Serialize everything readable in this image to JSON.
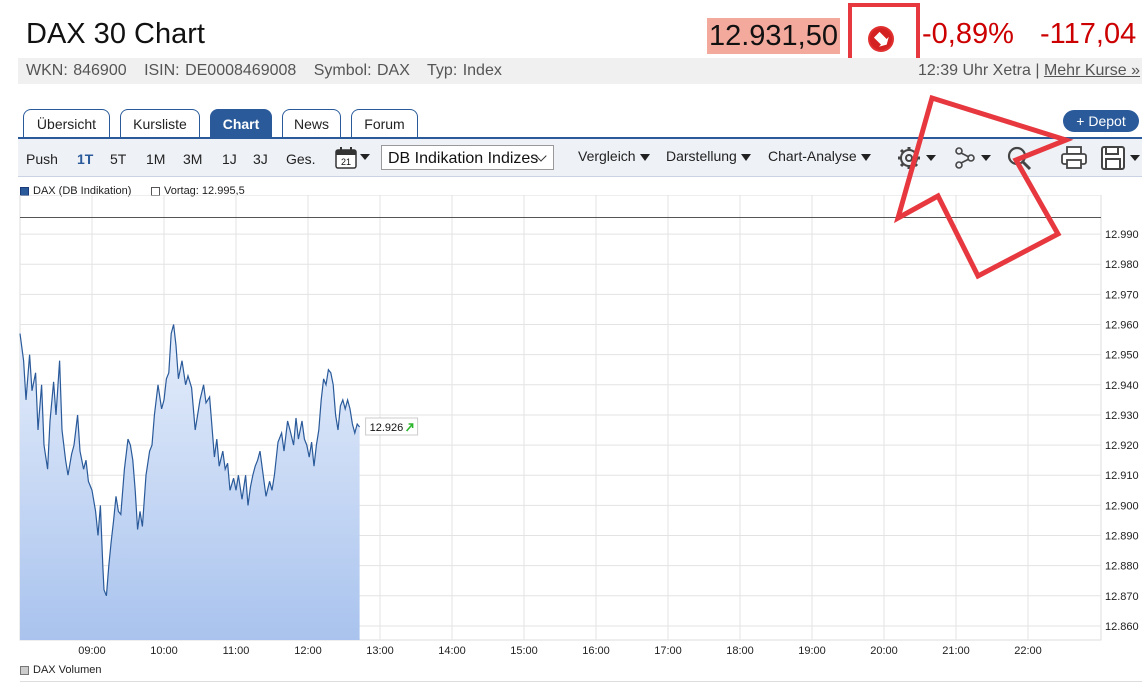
{
  "header": {
    "title": "DAX 30 Chart",
    "price": "12.931,50",
    "change_pct": "-0,89%",
    "change_abs": "-117,04",
    "wkn": "WKN: 846900",
    "isin": "ISIN: DE0008469008",
    "symbol": "Symbol: DAX",
    "type": "Typ: Index",
    "time_exchange": "12:39 Uhr Xetra | ",
    "more_quotes": "Mehr Kurse »",
    "colors": {
      "negative": "#cc0000",
      "price_bg": "#f4a99d",
      "highlight": "#e8383f"
    }
  },
  "tabs": [
    "Übersicht",
    "Kursliste",
    "Chart",
    "News",
    "Forum"
  ],
  "active_tab": "Chart",
  "depot_button": "+ Depot",
  "toolbar": {
    "push": "Push",
    "ranges": [
      "1T",
      "5T",
      "1M",
      "3M",
      "1J",
      "3J",
      "Ges."
    ],
    "active_range": "1T",
    "calendar_day": "21",
    "data_source": "DB Indikation Indizes",
    "vergleich": "Vergleich",
    "darstellung": "Darstellung",
    "chart_analyse": "Chart-Analyse",
    "icons": [
      "calendar-icon",
      "settings-icon",
      "network-icon",
      "zoom-icon",
      "print-icon",
      "save-icon"
    ]
  },
  "legend": {
    "series": "DAX (DB Indikation)",
    "previous": "Vortag: 12.995,5",
    "volume": "DAX Volumen"
  },
  "chart_data": {
    "type": "area",
    "x_ticks": [
      "09:00",
      "10:00",
      "11:00",
      "12:00",
      "13:00",
      "14:00",
      "15:00",
      "16:00",
      "17:00",
      "18:00",
      "19:00",
      "20:00",
      "21:00",
      "22:00"
    ],
    "y_ticks": [
      "12.990",
      "12.980",
      "12.970",
      "12.960",
      "12.950",
      "12.940",
      "12.930",
      "12.920",
      "12.910",
      "12.900",
      "12.890",
      "12.880",
      "12.870",
      "12.860"
    ],
    "ylim": [
      12856,
      12997
    ],
    "previous_close": 12995.5,
    "last_label": "12.926",
    "series": [
      {
        "name": "DAX (DB Indikation)",
        "color": "#2a5a9a",
        "points": [
          [
            "08:00",
            12957
          ],
          [
            "08:03",
            12948
          ],
          [
            "08:05",
            12935
          ],
          [
            "08:08",
            12950
          ],
          [
            "08:10",
            12938
          ],
          [
            "08:13",
            12944
          ],
          [
            "08:15",
            12925
          ],
          [
            "08:18",
            12940
          ],
          [
            "08:20",
            12920
          ],
          [
            "08:23",
            12912
          ],
          [
            "08:25",
            12928
          ],
          [
            "08:28",
            12941
          ],
          [
            "08:30",
            12930
          ],
          [
            "08:33",
            12948
          ],
          [
            "08:35",
            12925
          ],
          [
            "08:38",
            12915
          ],
          [
            "08:40",
            12910
          ],
          [
            "08:43",
            12917
          ],
          [
            "08:45",
            12920
          ],
          [
            "08:48",
            12930
          ],
          [
            "08:50",
            12918
          ],
          [
            "08:53",
            12912
          ],
          [
            "08:55",
            12915
          ],
          [
            "08:57",
            12908
          ],
          [
            "09:00",
            12905
          ],
          [
            "09:03",
            12898
          ],
          [
            "09:05",
            12890
          ],
          [
            "09:07",
            12900
          ],
          [
            "09:09",
            12880
          ],
          [
            "09:10",
            12872
          ],
          [
            "09:12",
            12870
          ],
          [
            "09:14",
            12880
          ],
          [
            "09:16",
            12888
          ],
          [
            "09:18",
            12895
          ],
          [
            "09:20",
            12903
          ],
          [
            "09:22",
            12898
          ],
          [
            "09:24",
            12897
          ],
          [
            "09:27",
            12912
          ],
          [
            "09:30",
            12922
          ],
          [
            "09:32",
            12920
          ],
          [
            "09:34",
            12915
          ],
          [
            "09:36",
            12905
          ],
          [
            "09:38",
            12892
          ],
          [
            "09:40",
            12898
          ],
          [
            "09:42",
            12893
          ],
          [
            "09:45",
            12910
          ],
          [
            "09:48",
            12918
          ],
          [
            "09:50",
            12920
          ],
          [
            "09:52",
            12930
          ],
          [
            "09:55",
            12940
          ],
          [
            "09:58",
            12932
          ],
          [
            "10:00",
            12935
          ],
          [
            "10:02",
            12942
          ],
          [
            "10:04",
            12944
          ],
          [
            "10:06",
            12957
          ],
          [
            "10:08",
            12960
          ],
          [
            "10:10",
            12953
          ],
          [
            "10:12",
            12942
          ],
          [
            "10:15",
            12948
          ],
          [
            "10:18",
            12940
          ],
          [
            "10:20",
            12943
          ],
          [
            "10:23",
            12939
          ],
          [
            "10:26",
            12925
          ],
          [
            "10:28",
            12930
          ],
          [
            "10:30",
            12935
          ],
          [
            "10:33",
            12940
          ],
          [
            "10:35",
            12934
          ],
          [
            "10:38",
            12936
          ],
          [
            "10:40",
            12926
          ],
          [
            "10:42",
            12916
          ],
          [
            "10:44",
            12922
          ],
          [
            "10:46",
            12913
          ],
          [
            "10:49",
            12918
          ],
          [
            "10:51",
            12912
          ],
          [
            "10:53",
            12914
          ],
          [
            "10:55",
            12905
          ],
          [
            "10:58",
            12909
          ],
          [
            "11:00",
            12905
          ],
          [
            "11:02",
            12910
          ],
          [
            "11:05",
            12902
          ],
          [
            "11:08",
            12910
          ],
          [
            "11:10",
            12900
          ],
          [
            "11:12",
            12906
          ],
          [
            "11:14",
            12910
          ],
          [
            "11:16",
            12913
          ],
          [
            "11:18",
            12915
          ],
          [
            "11:20",
            12918
          ],
          [
            "11:22",
            12912
          ],
          [
            "11:25",
            12903
          ],
          [
            "11:28",
            12908
          ],
          [
            "11:30",
            12905
          ],
          [
            "11:32",
            12910
          ],
          [
            "11:35",
            12921
          ],
          [
            "11:38",
            12924
          ],
          [
            "11:40",
            12918
          ],
          [
            "11:43",
            12928
          ],
          [
            "11:45",
            12925
          ],
          [
            "11:48",
            12920
          ],
          [
            "11:50",
            12929
          ],
          [
            "11:52",
            12922
          ],
          [
            "11:55",
            12928
          ],
          [
            "11:57",
            12922
          ],
          [
            "11:59",
            12920
          ],
          [
            "12:01",
            12916
          ],
          [
            "12:03",
            12921
          ],
          [
            "12:05",
            12913
          ],
          [
            "12:07",
            12920
          ],
          [
            "12:09",
            12925
          ],
          [
            "12:11",
            12935
          ],
          [
            "12:13",
            12942
          ],
          [
            "12:15",
            12940
          ],
          [
            "12:17",
            12945
          ],
          [
            "12:19",
            12944
          ],
          [
            "12:21",
            12940
          ],
          [
            "12:23",
            12930
          ],
          [
            "12:25",
            12925
          ],
          [
            "12:27",
            12933
          ],
          [
            "12:29",
            12935
          ],
          [
            "12:31",
            12932
          ],
          [
            "12:33",
            12935
          ],
          [
            "12:35",
            12932
          ],
          [
            "12:37",
            12927
          ],
          [
            "12:39",
            12924
          ],
          [
            "12:41",
            12927
          ],
          [
            "12:43",
            12926
          ]
        ]
      }
    ]
  }
}
